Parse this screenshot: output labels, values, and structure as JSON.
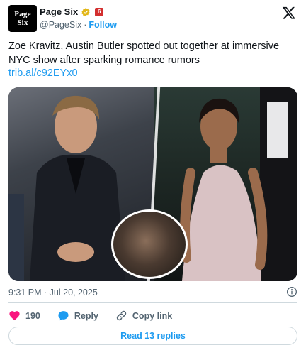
{
  "account": {
    "avatar_line1": "Page",
    "avatar_line2": "Six",
    "name": "Page Six",
    "brand_badge": "6",
    "handle": "@PageSix",
    "separator": "·",
    "follow_label": "Follow"
  },
  "tweet": {
    "text": "Zoe Kravitz, Austin Butler spotted out together at immersive NYC show after sparking romance rumors",
    "link": "trib.al/c92EYx0",
    "timestamp": "9:31 PM · Jul 20, 2025"
  },
  "actions": {
    "like_count": "190",
    "reply_label": "Reply",
    "copy_link_label": "Copy link",
    "read_replies_label": "Read 13 replies"
  },
  "colors": {
    "accent": "#1d9bf0",
    "like": "#f91880",
    "muted": "#536471",
    "badge": "#d32f2f"
  },
  "icons": [
    "verified-badge-icon",
    "x-logo-icon",
    "info-icon",
    "heart-icon",
    "reply-bubble-icon",
    "link-icon"
  ]
}
